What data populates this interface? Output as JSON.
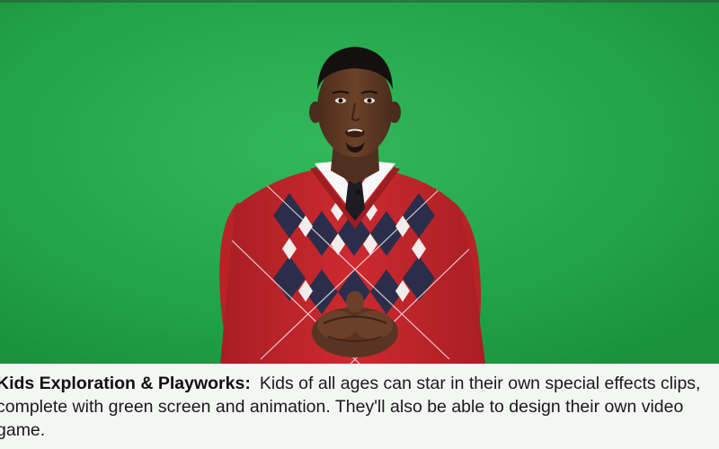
{
  "caption": {
    "title": "Kids Exploration & Playworks:",
    "body": "Kids of all ages can star in their own special effects clips, complete with green screen and animation.  They'll also be able to design their own video game."
  },
  "colors": {
    "backdrop": "#23a84a",
    "sweater": "#c8282d",
    "argyle_dark": "#2b2e4a",
    "argyle_light": "#f2ecea",
    "caption_bg": "#f4f6f4"
  },
  "icons": {
    "presenter": "person-photo",
    "lapel_microphone": "microphone-icon"
  }
}
